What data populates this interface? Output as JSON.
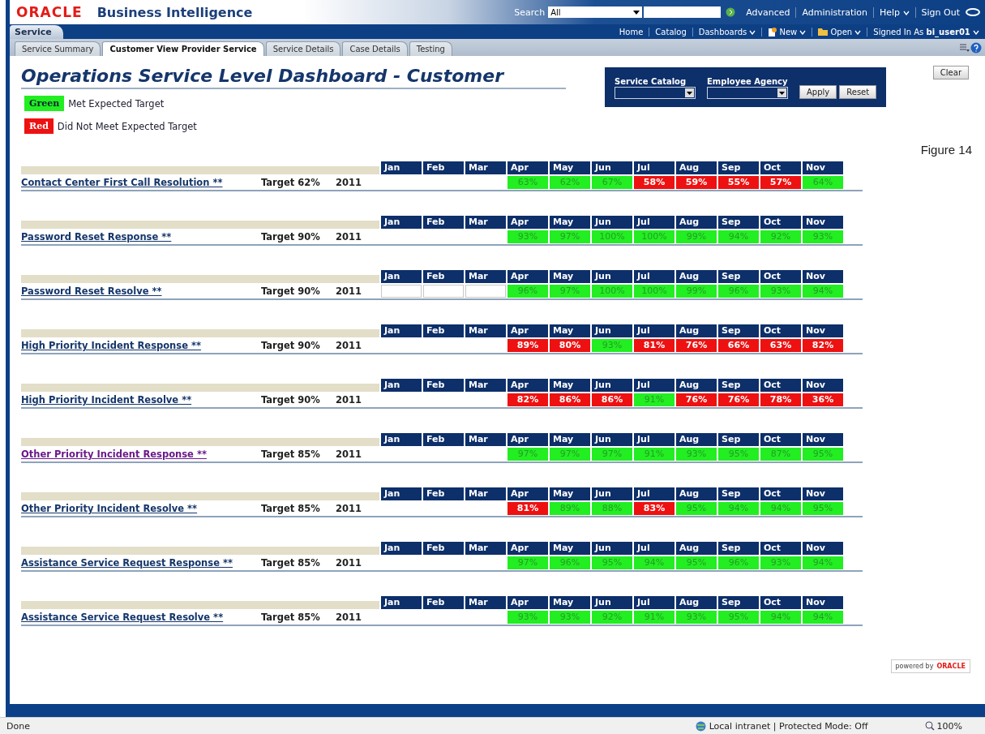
{
  "header": {
    "logo": "ORACLE",
    "product": "Business Intelligence",
    "search_label": "Search",
    "search_scope": "All",
    "links": [
      "Advanced",
      "Administration",
      "Help",
      "Sign Out"
    ]
  },
  "nav": {
    "dashboard_tab": "Service",
    "links": [
      {
        "label": "Home",
        "menu": false
      },
      {
        "label": "Catalog",
        "menu": false
      },
      {
        "label": "Dashboards",
        "menu": true
      },
      {
        "label": "New",
        "menu": true
      },
      {
        "label": "Open",
        "menu": true
      }
    ],
    "signed_in_label": "Signed In As",
    "user": "bi_user01"
  },
  "tabs": [
    {
      "label": "Service Summary",
      "selected": false
    },
    {
      "label": "Customer View Provider Service",
      "selected": true
    },
    {
      "label": "Service Details",
      "selected": false
    },
    {
      "label": "Case Details",
      "selected": false
    },
    {
      "label": "Testing",
      "selected": false
    }
  ],
  "title": "Operations Service Level Dashboard - Customer",
  "legend": [
    {
      "swatch": "Green",
      "color": "#22ee22",
      "text": "Met Expected Target"
    },
    {
      "swatch": "Red",
      "color": "#ee1111",
      "text": "Did Not Meet Expected Target"
    }
  ],
  "prompts": {
    "fields": [
      {
        "label": "Service Catalog"
      },
      {
        "label": "Employee Agency"
      }
    ],
    "buttons": [
      "Apply",
      "Reset"
    ]
  },
  "clear_button": "Clear",
  "figure_caption": "Figure 14",
  "metrics": [
    {
      "name": "Contact Center First Call Resolution **",
      "visited": false,
      "target": "Target 62%",
      "year": "2011",
      "months": [
        "Jan",
        "Feb",
        "Mar",
        "Apr",
        "May",
        "Jun",
        "Jul",
        "Aug",
        "Sep",
        "Oct",
        "Nov"
      ],
      "values": [
        {
          "kind": "empty"
        },
        {
          "kind": "empty"
        },
        {
          "kind": "empty"
        },
        {
          "kind": "value",
          "met": true,
          "value": "63%"
        },
        {
          "kind": "value",
          "met": true,
          "value": "62%"
        },
        {
          "kind": "value",
          "met": true,
          "value": "67%"
        },
        {
          "kind": "value",
          "met": false,
          "value": "58%"
        },
        {
          "kind": "value",
          "met": false,
          "value": "59%"
        },
        {
          "kind": "value",
          "met": false,
          "value": "55%"
        },
        {
          "kind": "value",
          "met": false,
          "value": "57%"
        },
        {
          "kind": "value",
          "met": true,
          "value": "64%"
        }
      ]
    },
    {
      "name": "Password Reset Response **",
      "visited": false,
      "target": "Target 90%",
      "year": "2011",
      "months": [
        "Jan",
        "Feb",
        "Mar",
        "Apr",
        "May",
        "Jun",
        "Jul",
        "Aug",
        "Sep",
        "Oct",
        "Nov"
      ],
      "values": [
        {
          "kind": "empty"
        },
        {
          "kind": "empty"
        },
        {
          "kind": "empty"
        },
        {
          "kind": "value",
          "met": true,
          "value": "93%"
        },
        {
          "kind": "value",
          "met": true,
          "value": "97%"
        },
        {
          "kind": "value",
          "met": true,
          "value": "100%"
        },
        {
          "kind": "value",
          "met": true,
          "value": "100%"
        },
        {
          "kind": "value",
          "met": true,
          "value": "99%"
        },
        {
          "kind": "value",
          "met": true,
          "value": "94%"
        },
        {
          "kind": "value",
          "met": true,
          "value": "92%"
        },
        {
          "kind": "value",
          "met": true,
          "value": "93%"
        }
      ]
    },
    {
      "name": "Password Reset Resolve **",
      "visited": false,
      "target": "Target 90%",
      "year": "2011",
      "months": [
        "Jan",
        "Feb",
        "Mar",
        "Apr",
        "May",
        "Jun",
        "Jul",
        "Aug",
        "Sep",
        "Oct",
        "Nov"
      ],
      "values": [
        {
          "kind": "boxed"
        },
        {
          "kind": "boxed"
        },
        {
          "kind": "boxed"
        },
        {
          "kind": "value",
          "met": true,
          "value": "96%"
        },
        {
          "kind": "value",
          "met": true,
          "value": "97%"
        },
        {
          "kind": "value",
          "met": true,
          "value": "100%"
        },
        {
          "kind": "value",
          "met": true,
          "value": "100%"
        },
        {
          "kind": "value",
          "met": true,
          "value": "99%"
        },
        {
          "kind": "value",
          "met": true,
          "value": "96%"
        },
        {
          "kind": "value",
          "met": true,
          "value": "93%"
        },
        {
          "kind": "value",
          "met": true,
          "value": "94%"
        }
      ]
    },
    {
      "name": "High Priority Incident Response **",
      "visited": false,
      "target": "Target 90%",
      "year": "2011",
      "months": [
        "Jan",
        "Feb",
        "Mar",
        "Apr",
        "May",
        "Jun",
        "Jul",
        "Aug",
        "Sep",
        "Oct",
        "Nov"
      ],
      "values": [
        {
          "kind": "empty"
        },
        {
          "kind": "empty"
        },
        {
          "kind": "empty"
        },
        {
          "kind": "value",
          "met": false,
          "value": "89%"
        },
        {
          "kind": "value",
          "met": false,
          "value": "80%"
        },
        {
          "kind": "value",
          "met": true,
          "value": "93%"
        },
        {
          "kind": "value",
          "met": false,
          "value": "81%"
        },
        {
          "kind": "value",
          "met": false,
          "value": "76%"
        },
        {
          "kind": "value",
          "met": false,
          "value": "66%"
        },
        {
          "kind": "value",
          "met": false,
          "value": "63%"
        },
        {
          "kind": "value",
          "met": false,
          "value": "82%"
        }
      ]
    },
    {
      "name": "High Priority Incident Resolve **",
      "visited": false,
      "target": "Target 90%",
      "year": "2011",
      "months": [
        "Jan",
        "Feb",
        "Mar",
        "Apr",
        "May",
        "Jun",
        "Jul",
        "Aug",
        "Sep",
        "Oct",
        "Nov"
      ],
      "values": [
        {
          "kind": "empty"
        },
        {
          "kind": "empty"
        },
        {
          "kind": "empty"
        },
        {
          "kind": "value",
          "met": false,
          "value": "82%"
        },
        {
          "kind": "value",
          "met": false,
          "value": "86%"
        },
        {
          "kind": "value",
          "met": false,
          "value": "86%"
        },
        {
          "kind": "value",
          "met": true,
          "value": "91%"
        },
        {
          "kind": "value",
          "met": false,
          "value": "76%"
        },
        {
          "kind": "value",
          "met": false,
          "value": "76%"
        },
        {
          "kind": "value",
          "met": false,
          "value": "78%"
        },
        {
          "kind": "value",
          "met": false,
          "value": "36%"
        }
      ]
    },
    {
      "name": "Other Priority Incident Response **",
      "visited": true,
      "target": "Target 85%",
      "year": "2011",
      "months": [
        "Jan",
        "Feb",
        "Mar",
        "Apr",
        "May",
        "Jun",
        "Jul",
        "Aug",
        "Sep",
        "Oct",
        "Nov"
      ],
      "values": [
        {
          "kind": "empty"
        },
        {
          "kind": "empty"
        },
        {
          "kind": "empty"
        },
        {
          "kind": "value",
          "met": true,
          "value": "97%"
        },
        {
          "kind": "value",
          "met": true,
          "value": "97%"
        },
        {
          "kind": "value",
          "met": true,
          "value": "97%"
        },
        {
          "kind": "value",
          "met": true,
          "value": "91%"
        },
        {
          "kind": "value",
          "met": true,
          "value": "93%"
        },
        {
          "kind": "value",
          "met": true,
          "value": "95%"
        },
        {
          "kind": "value",
          "met": true,
          "value": "87%"
        },
        {
          "kind": "value",
          "met": true,
          "value": "95%"
        }
      ]
    },
    {
      "name": "Other Priority Incident Resolve **",
      "visited": false,
      "target": "Target 85%",
      "year": "2011",
      "months": [
        "Jan",
        "Feb",
        "Mar",
        "Apr",
        "May",
        "Jun",
        "Jul",
        "Aug",
        "Sep",
        "Oct",
        "Nov"
      ],
      "values": [
        {
          "kind": "empty"
        },
        {
          "kind": "empty"
        },
        {
          "kind": "empty"
        },
        {
          "kind": "value",
          "met": false,
          "value": "81%"
        },
        {
          "kind": "value",
          "met": true,
          "value": "89%"
        },
        {
          "kind": "value",
          "met": true,
          "value": "88%"
        },
        {
          "kind": "value",
          "met": false,
          "value": "83%"
        },
        {
          "kind": "value",
          "met": true,
          "value": "95%"
        },
        {
          "kind": "value",
          "met": true,
          "value": "94%"
        },
        {
          "kind": "value",
          "met": true,
          "value": "94%"
        },
        {
          "kind": "value",
          "met": true,
          "value": "95%"
        }
      ]
    },
    {
      "name": "Assistance Service Request Response **",
      "visited": false,
      "target": "Target 85%",
      "year": "2011",
      "months": [
        "Jan",
        "Feb",
        "Mar",
        "Apr",
        "May",
        "Jun",
        "Jul",
        "Aug",
        "Sep",
        "Oct",
        "Nov"
      ],
      "values": [
        {
          "kind": "empty"
        },
        {
          "kind": "empty"
        },
        {
          "kind": "empty"
        },
        {
          "kind": "value",
          "met": true,
          "value": "97%"
        },
        {
          "kind": "value",
          "met": true,
          "value": "96%"
        },
        {
          "kind": "value",
          "met": true,
          "value": "95%"
        },
        {
          "kind": "value",
          "met": true,
          "value": "94%"
        },
        {
          "kind": "value",
          "met": true,
          "value": "95%"
        },
        {
          "kind": "value",
          "met": true,
          "value": "96%"
        },
        {
          "kind": "value",
          "met": true,
          "value": "93%"
        },
        {
          "kind": "value",
          "met": true,
          "value": "94%"
        }
      ]
    },
    {
      "name": "Assistance Service Request Resolve **",
      "visited": false,
      "target": "Target 85%",
      "year": "2011",
      "months": [
        "Jan",
        "Feb",
        "Mar",
        "Apr",
        "May",
        "Jun",
        "Jul",
        "Aug",
        "Sep",
        "Oct",
        "Nov"
      ],
      "values": [
        {
          "kind": "empty"
        },
        {
          "kind": "empty"
        },
        {
          "kind": "empty"
        },
        {
          "kind": "value",
          "met": true,
          "value": "93%"
        },
        {
          "kind": "value",
          "met": true,
          "value": "93%"
        },
        {
          "kind": "value",
          "met": true,
          "value": "92%"
        },
        {
          "kind": "value",
          "met": true,
          "value": "91%"
        },
        {
          "kind": "value",
          "met": true,
          "value": "93%"
        },
        {
          "kind": "value",
          "met": true,
          "value": "95%"
        },
        {
          "kind": "value",
          "met": true,
          "value": "94%"
        },
        {
          "kind": "value",
          "met": true,
          "value": "94%"
        }
      ]
    }
  ],
  "powered_by": {
    "text": "powered by",
    "brand": "ORACLE"
  },
  "status_bar": {
    "left": "Done",
    "zone": "Local intranet | Protected Mode: Off",
    "zoom": "100%"
  }
}
